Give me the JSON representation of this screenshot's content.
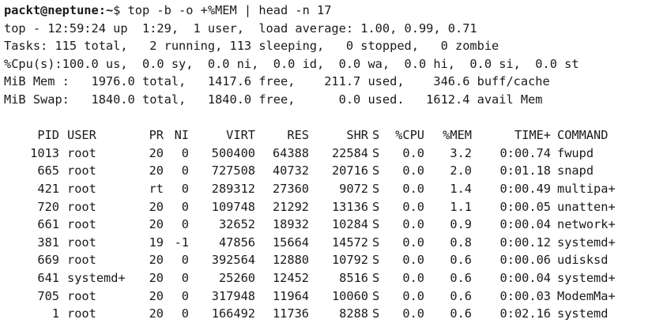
{
  "prompt": {
    "user_host": "packt@neptune",
    "path": ":~",
    "symbol": "$",
    "command": " top -b -o +%MEM | head -n 17"
  },
  "summary": {
    "line1": "top - 12:59:24 up  1:29,  1 user,  load average: 1.00, 0.99, 0.71",
    "line2": "Tasks: 115 total,   2 running, 113 sleeping,   0 stopped,   0 zombie",
    "line3": "%Cpu(s):100.0 us,  0.0 sy,  0.0 ni,  0.0 id,  0.0 wa,  0.0 hi,  0.0 si,  0.0 st",
    "line4": "MiB Mem :   1976.0 total,   1417.6 free,    211.7 used,    346.6 buff/cache",
    "line5": "MiB Swap:   1840.0 total,   1840.0 free,      0.0 used.   1612.4 avail Mem"
  },
  "table": {
    "headers": {
      "pid": "PID",
      "user": "USER",
      "pr": "PR",
      "ni": "NI",
      "virt": "VIRT",
      "res": "RES",
      "shr": "SHR",
      "s": "S",
      "cpu": "%CPU",
      "mem": "%MEM",
      "time": "TIME+",
      "command": "COMMAND"
    },
    "rows": [
      {
        "pid": "1013",
        "user": "root",
        "pr": "20",
        "ni": "0",
        "virt": "500400",
        "res": "64388",
        "shr": "22584",
        "s": "S",
        "cpu": "0.0",
        "mem": "3.2",
        "time": "0:00.74",
        "command": "fwupd"
      },
      {
        "pid": "665",
        "user": "root",
        "pr": "20",
        "ni": "0",
        "virt": "727508",
        "res": "40732",
        "shr": "20716",
        "s": "S",
        "cpu": "0.0",
        "mem": "2.0",
        "time": "0:01.18",
        "command": "snapd"
      },
      {
        "pid": "421",
        "user": "root",
        "pr": "rt",
        "ni": "0",
        "virt": "289312",
        "res": "27360",
        "shr": "9072",
        "s": "S",
        "cpu": "0.0",
        "mem": "1.4",
        "time": "0:00.49",
        "command": "multipa+"
      },
      {
        "pid": "720",
        "user": "root",
        "pr": "20",
        "ni": "0",
        "virt": "109748",
        "res": "21292",
        "shr": "13136",
        "s": "S",
        "cpu": "0.0",
        "mem": "1.1",
        "time": "0:00.05",
        "command": "unatten+"
      },
      {
        "pid": "661",
        "user": "root",
        "pr": "20",
        "ni": "0",
        "virt": "32652",
        "res": "18932",
        "shr": "10284",
        "s": "S",
        "cpu": "0.0",
        "mem": "0.9",
        "time": "0:00.04",
        "command": "network+"
      },
      {
        "pid": "381",
        "user": "root",
        "pr": "19",
        "ni": "-1",
        "virt": "47856",
        "res": "15664",
        "shr": "14572",
        "s": "S",
        "cpu": "0.0",
        "mem": "0.8",
        "time": "0:00.12",
        "command": "systemd+"
      },
      {
        "pid": "669",
        "user": "root",
        "pr": "20",
        "ni": "0",
        "virt": "392564",
        "res": "12880",
        "shr": "10792",
        "s": "S",
        "cpu": "0.0",
        "mem": "0.6",
        "time": "0:00.06",
        "command": "udisksd"
      },
      {
        "pid": "641",
        "user": "systemd+",
        "pr": "20",
        "ni": "0",
        "virt": "25260",
        "res": "12452",
        "shr": "8516",
        "s": "S",
        "cpu": "0.0",
        "mem": "0.6",
        "time": "0:00.04",
        "command": "systemd+"
      },
      {
        "pid": "705",
        "user": "root",
        "pr": "20",
        "ni": "0",
        "virt": "317948",
        "res": "11964",
        "shr": "10060",
        "s": "S",
        "cpu": "0.0",
        "mem": "0.6",
        "time": "0:00.03",
        "command": "ModemMa+"
      },
      {
        "pid": "1",
        "user": "root",
        "pr": "20",
        "ni": "0",
        "virt": "166492",
        "res": "11736",
        "shr": "8288",
        "s": "S",
        "cpu": "0.0",
        "mem": "0.6",
        "time": "0:02.16",
        "command": "systemd"
      }
    ]
  }
}
